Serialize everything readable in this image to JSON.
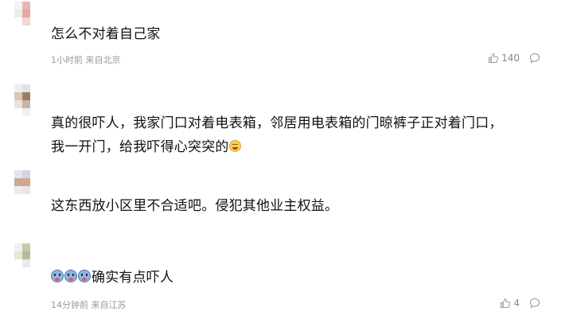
{
  "comments": [
    {
      "text": "怎么不对着自己家",
      "time": "1小时前",
      "location": "来自北京",
      "likes": "140",
      "avatar_colors": [
        "#ffffff",
        "#f3f3f3",
        "#e9b7b3",
        "#ffffff",
        "#ffffff",
        "#ececec",
        "#e4a9a2",
        "#ffffff",
        "#ffffff",
        "#ffffff",
        "#f0d8d4",
        "#ffffff",
        "#ffffff",
        "#ffffff",
        "#ffffff",
        "#ffffff"
      ]
    },
    {
      "lines": [
        "真的很吓人，我家门口对着电表箱，邻居用电表箱的门晾裤子正对着门口，",
        "我一开门，给我吓得心突突的"
      ],
      "avatar_colors": [
        "#ffffff",
        "#eeeeee",
        "#e2e2e2",
        "#ffffff",
        "#ffffff",
        "#d6c7b8",
        "#9c7f62",
        "#ffffff",
        "#ffffff",
        "#eae3dc",
        "#c6b6a4",
        "#ffffff",
        "#ffffff",
        "#ffffff",
        "#f1f1f1",
        "#ffffff"
      ]
    },
    {
      "text": "这东西放小区里不合适吧。侵犯其他业主权益。",
      "avatar_colors": [
        "#ffffff",
        "#e5e5e5",
        "#cdd6e8",
        "#ffffff",
        "#ffffff",
        "#c6aa92",
        "#d5a78a",
        "#ffffff",
        "#ffffff",
        "#ececec",
        "#e6e6e6",
        "#ffffff",
        "#ffffff",
        "#ffffff",
        "#ffffff",
        "#ffffff"
      ]
    },
    {
      "text": "确实有点吓人",
      "time": "14分钟前",
      "location": "来自江苏",
      "likes": "4",
      "avatar_colors": [
        "#ffffff",
        "#f0f0f0",
        "#c5c9a8",
        "#ffffff",
        "#ffffff",
        "#e4e8d4",
        "#b9bc9a",
        "#ffffff",
        "#ffffff",
        "#ffffff",
        "#e9e9e9",
        "#ffffff",
        "#ffffff",
        "#ffffff",
        "#ffffff",
        "#ffffff"
      ]
    }
  ],
  "icons": {
    "like": "thumbs-up-icon",
    "reply": "comment-bubble-icon",
    "emoji_laugh": "laughing-emoji-icon",
    "emoji_scared": "scared-emoji-icon"
  }
}
